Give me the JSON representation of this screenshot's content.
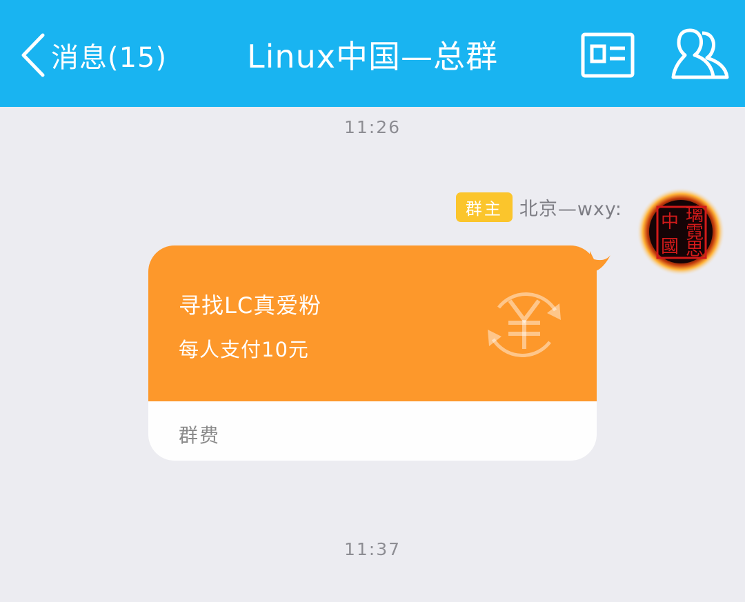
{
  "header": {
    "back_label": "消息(15)",
    "title": "Linux中国—总群",
    "background": "#19b4f1"
  },
  "timestamps": [
    "11:26",
    "11:37"
  ],
  "message": {
    "role_badge": "群主",
    "sender": "北京—wxy:",
    "avatar_seal_chars": [
      "中",
      "國",
      "璃",
      "霓",
      "思"
    ],
    "card": {
      "title": "寻找LC真爱粉",
      "subtitle": "每人支付10元",
      "footer": "群费",
      "accent": "#fd982b",
      "icon": "yuan-refresh-icon"
    }
  },
  "icons": {
    "back": "chevron-left-icon",
    "profile_card": "id-card-icon",
    "members": "group-members-icon"
  }
}
